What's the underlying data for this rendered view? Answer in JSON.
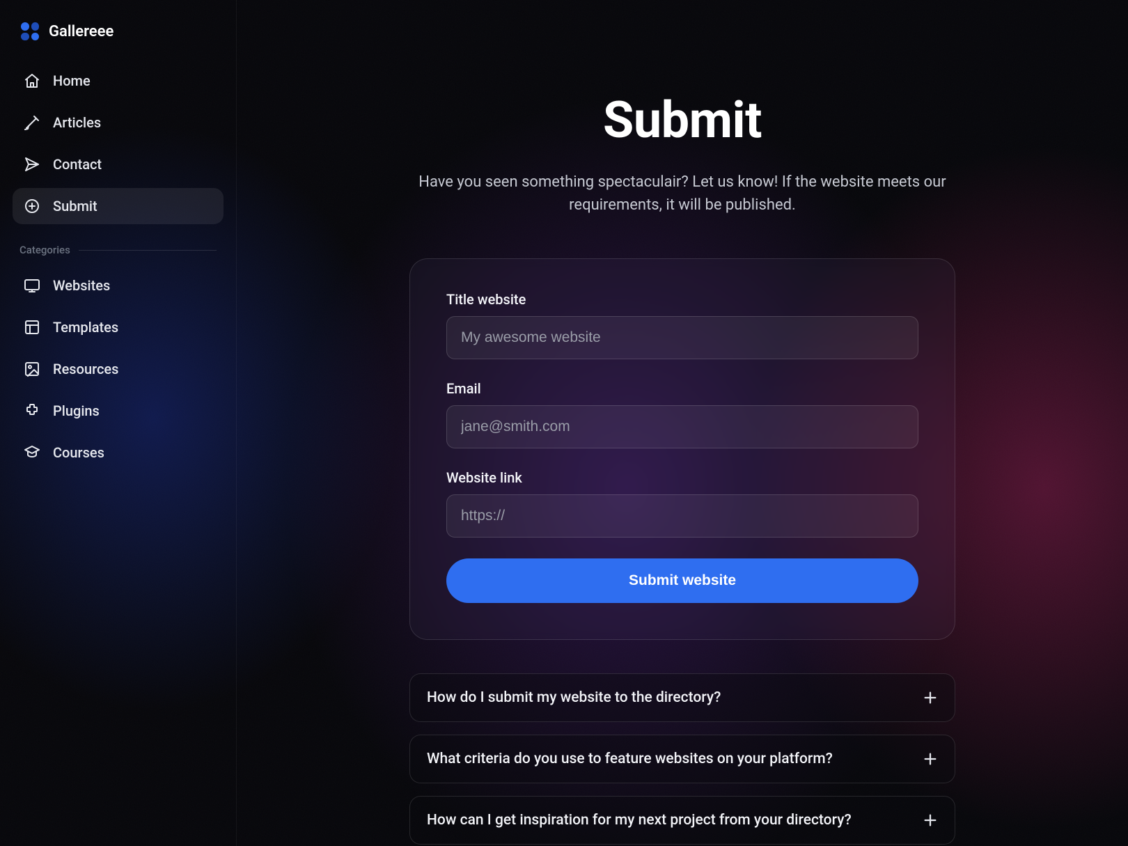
{
  "brand": {
    "name": "Gallereee"
  },
  "sidebar": {
    "items": [
      {
        "label": "Home",
        "icon": "home-icon"
      },
      {
        "label": "Articles",
        "icon": "articles-icon"
      },
      {
        "label": "Contact",
        "icon": "contact-icon"
      },
      {
        "label": "Submit",
        "icon": "submit-icon",
        "active": true
      }
    ],
    "categories_label": "Categories",
    "categories": [
      {
        "label": "Websites",
        "icon": "websites-icon"
      },
      {
        "label": "Templates",
        "icon": "templates-icon"
      },
      {
        "label": "Resources",
        "icon": "resources-icon"
      },
      {
        "label": "Plugins",
        "icon": "plugins-icon"
      },
      {
        "label": "Courses",
        "icon": "courses-icon"
      }
    ]
  },
  "page": {
    "title": "Submit",
    "subtitle": "Have you seen something spectaculair? Let us know! If the website meets our requirements, it will be published."
  },
  "form": {
    "title_label": "Title website",
    "title_placeholder": "My awesome website",
    "email_label": "Email",
    "email_placeholder": "jane@smith.com",
    "link_label": "Website link",
    "link_placeholder": "https://",
    "submit_label": "Submit website"
  },
  "faq": [
    {
      "question": "How do I submit my website to the directory?"
    },
    {
      "question": "What criteria do you use to feature websites on your platform?"
    },
    {
      "question": "How can I get inspiration for my next project from your directory?"
    }
  ],
  "colors": {
    "accent": "#2f6ef0"
  }
}
